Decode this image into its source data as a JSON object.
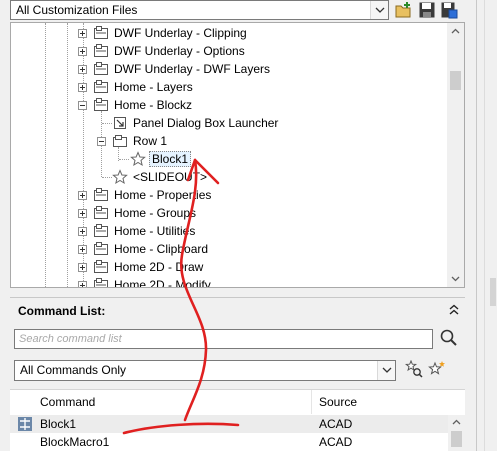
{
  "toolbar": {
    "file_select_value": "All Customization Files",
    "icons": [
      "open-file-icon",
      "save-icon",
      "save-as-icon"
    ]
  },
  "tree": {
    "items": [
      {
        "label": "DWF Underlay - Clipping"
      },
      {
        "label": "DWF Underlay - Options"
      },
      {
        "label": "DWF Underlay - DWF Layers"
      },
      {
        "label": "Home - Layers"
      },
      {
        "label": "Home - Blockz"
      },
      {
        "label": "Panel Dialog Box Launcher"
      },
      {
        "label": "Row 1"
      },
      {
        "label": "Block1"
      },
      {
        "label": "<SLIDEOUT>"
      },
      {
        "label": "Home - Properties"
      },
      {
        "label": "Home - Groups"
      },
      {
        "label": "Home - Utilities"
      },
      {
        "label": "Home - Clipboard"
      },
      {
        "label": "Home 2D - Draw"
      },
      {
        "label": "Home 2D - Modify"
      }
    ]
  },
  "command_list": {
    "title": "Command List:",
    "search_placeholder": "Search command list",
    "filter_value": "All Commands Only",
    "columns": {
      "command": "Command",
      "source": "Source"
    },
    "rows": [
      {
        "command": "Block1",
        "source": "ACAD"
      },
      {
        "command": "BlockMacro1",
        "source": "ACAD"
      }
    ]
  },
  "colors": {
    "annotation": "#e02020",
    "selection": "#e5f3ff"
  }
}
